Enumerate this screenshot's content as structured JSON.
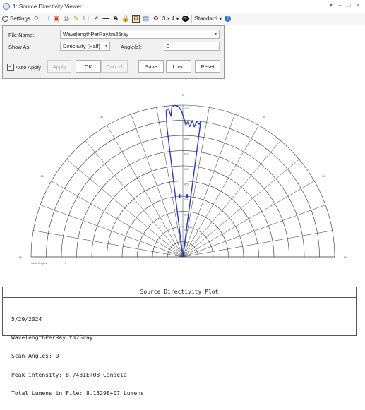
{
  "window": {
    "title": "1: Source Directivity Viewer",
    "controls": [
      "▾",
      "−",
      "□",
      "×"
    ]
  },
  "toolbar": {
    "settings_label": "Settings",
    "layout_label": "3 x 4 ▾",
    "standard_label": "Standard ▾"
  },
  "settings": {
    "file_name_label": "File Name:",
    "file_name_value": "WavelengthPerRay.tm25ray",
    "show_as_label": "Show As:",
    "show_as_value": "Directivity (Half)",
    "angles_label": "Angle(s):",
    "angles_value": "0",
    "auto_apply_label": "Auto Apply",
    "apply_label": "Apply",
    "ok_label": "OK",
    "cancel_label": "Cancel",
    "save_label": "Save",
    "load_label": "Load",
    "reset_label": "Reset"
  },
  "chart_data": {
    "type": "polar-half",
    "angle_labels": [
      "0",
      "30",
      "60",
      "90",
      "30",
      "60",
      "90"
    ],
    "radial_labels": [
      "1.0",
      "0.9",
      "0.8",
      "0.7",
      "0.6",
      "0.5",
      "0.4",
      "0.3",
      "0.2",
      "0.1"
    ],
    "radial_range": [
      0,
      1.0
    ],
    "scan_angles_label": "Scan Angles:",
    "scan_angles_value": "0",
    "series_color": "#2a3bb8",
    "series": [
      {
        "angle": -7,
        "r": 0.86
      },
      {
        "angle": -6.5,
        "r": 0.97
      },
      {
        "angle": -5.5,
        "r": 0.98
      },
      {
        "angle": -4.8,
        "r": 0.93
      },
      {
        "angle": -4.2,
        "r": 0.99
      },
      {
        "angle": -3,
        "r": 1.0
      },
      {
        "angle": -1.5,
        "r": 0.99
      },
      {
        "angle": -0.5,
        "r": 0.96
      },
      {
        "angle": 0.5,
        "r": 0.91
      },
      {
        "angle": 1.3,
        "r": 0.87
      },
      {
        "angle": 2.0,
        "r": 0.89
      },
      {
        "angle": 3.0,
        "r": 0.86
      },
      {
        "angle": 4.0,
        "r": 0.9
      },
      {
        "angle": 5.0,
        "r": 0.86
      },
      {
        "angle": 6.0,
        "r": 0.9
      },
      {
        "angle": 7.0,
        "r": 0.88
      },
      {
        "angle": 7.5,
        "r": 0.9
      }
    ]
  },
  "panel": {
    "title": "Source Directivity Plot",
    "lines": [
      "5/29/2024",
      "WavelengthPerRay.tm25ray",
      "Scan Angles: 0",
      "Peak intensity: 8.7431E+08 Candela",
      "Total Lumens in File: 8.1329E+07 Lumens"
    ]
  }
}
